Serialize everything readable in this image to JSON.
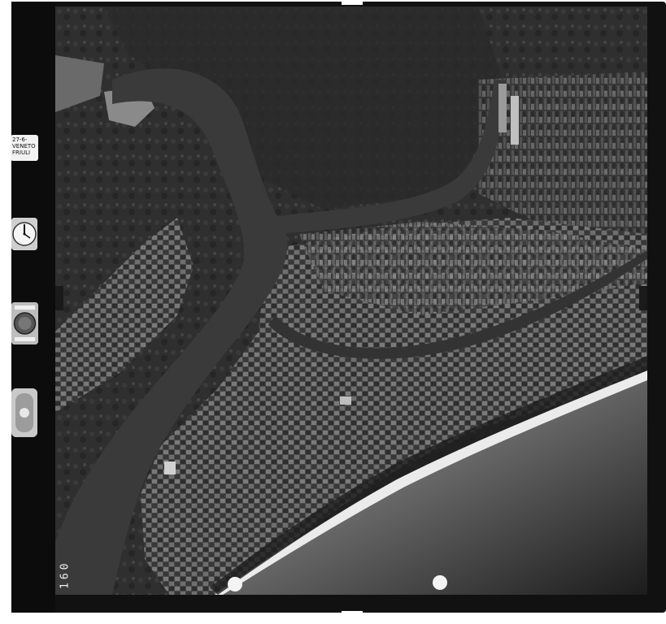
{
  "film": {
    "region_card_line1": "27-6-",
    "region_card_line2": "VENETO",
    "region_card_line3": "FRIULI",
    "frame_number": "160"
  },
  "colors": {
    "sea": "#2a2a2a",
    "beach": "#e6e6e6",
    "river": "#3d3d3d",
    "land_dark": "#262626",
    "fields": "#5a5a5a",
    "frame": "#111111"
  }
}
